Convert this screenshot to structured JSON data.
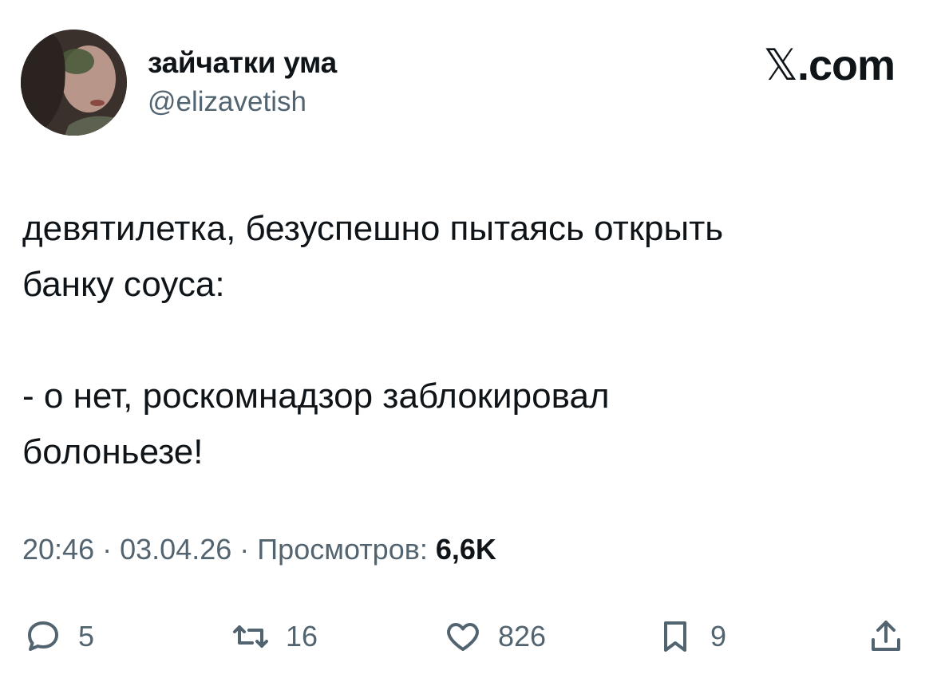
{
  "author": {
    "display_name": "зайчатки ума",
    "handle": "@elizavetish"
  },
  "brand": {
    "x_glyph": "𝕏",
    "domain": ".com"
  },
  "tweet": {
    "text": "девятилетка, безуспешно пытаясь открыть\nбанку соуса:\n\n- о нет, роскомнадзор заблокировал\nболоньезе!"
  },
  "meta": {
    "time": "20:46",
    "separator": "·",
    "date": "03.04.26",
    "views_label": "Просмотров:",
    "views_count": "6,6K"
  },
  "actions": {
    "replies": "5",
    "reposts": "16",
    "likes": "826",
    "bookmarks": "9"
  },
  "icons": {
    "reply": "reply-icon",
    "repost": "repost-icon",
    "like": "heart-icon",
    "bookmark": "bookmark-icon",
    "share": "share-icon"
  },
  "colors": {
    "text": "#0f1419",
    "secondary": "#536471"
  }
}
